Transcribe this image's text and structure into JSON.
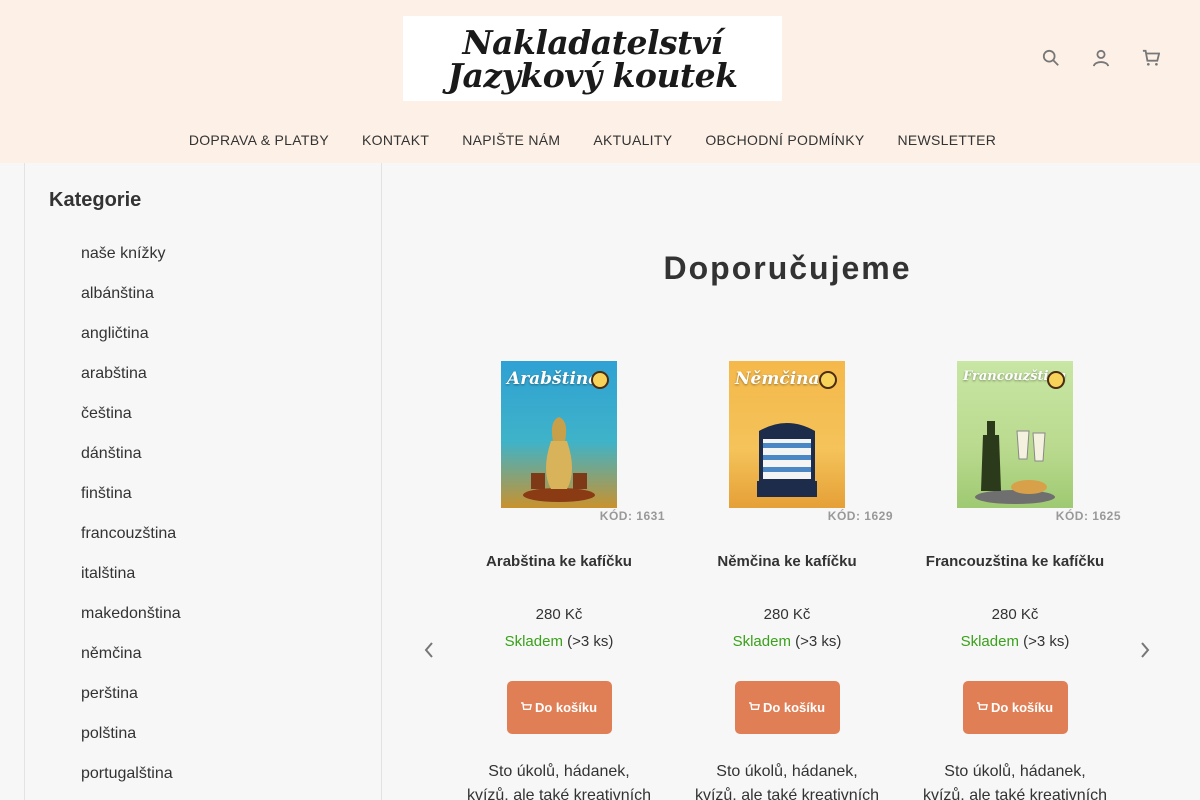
{
  "header": {
    "logo_line1": "Nakladatelství",
    "logo_line2": "Jazykový koutek",
    "icons": [
      "search-icon",
      "user-icon",
      "cart-icon"
    ]
  },
  "nav": [
    {
      "label": "DOPRAVA & PLATBY"
    },
    {
      "label": "KONTAKT"
    },
    {
      "label": "NAPIŠTE NÁM"
    },
    {
      "label": "AKTUALITY"
    },
    {
      "label": "OBCHODNÍ PODMÍNKY"
    },
    {
      "label": "NEWSLETTER"
    }
  ],
  "sidebar": {
    "title": "Kategorie",
    "categories": [
      "naše knížky",
      "albánština",
      "angličtina",
      "arabština",
      "čeština",
      "dánština",
      "finština",
      "francouzština",
      "italština",
      "makedonština",
      "němčina",
      "perština",
      "polština",
      "portugalština"
    ]
  },
  "main": {
    "title": "Doporučujeme"
  },
  "products": [
    {
      "cover_title": "Arabština",
      "sku": "KÓD: 1631",
      "name": "Arabština ke kafíčku",
      "price": "280 Kč",
      "stock_status": "Skladem",
      "stock_qty": "(>3 ks)",
      "button": "Do košíku",
      "desc_line1": "Sto úkolů, hádanek,",
      "desc_line2": "kvízů, ale také kreativních"
    },
    {
      "cover_title": "Němčina",
      "sku": "KÓD: 1629",
      "name": "Němčina ke kafíčku",
      "price": "280 Kč",
      "stock_status": "Skladem",
      "stock_qty": "(>3 ks)",
      "button": "Do košíku",
      "desc_line1": "Sto úkolů, hádanek,",
      "desc_line2": "kvízů, ale také kreativních"
    },
    {
      "cover_title": "Francouzština",
      "sku": "KÓD: 1625",
      "name": "Francouzština ke kafíčku",
      "price": "280 Kč",
      "stock_status": "Skladem",
      "stock_qty": "(>3 ks)",
      "button": "Do košíku",
      "desc_line1": "Sto úkolů, hádanek,",
      "desc_line2": "kvízů, ale také kreativních"
    }
  ],
  "colors": {
    "header_bg": "#fdf0e7",
    "button": "#e07f55",
    "in_stock": "#3aa11a"
  }
}
